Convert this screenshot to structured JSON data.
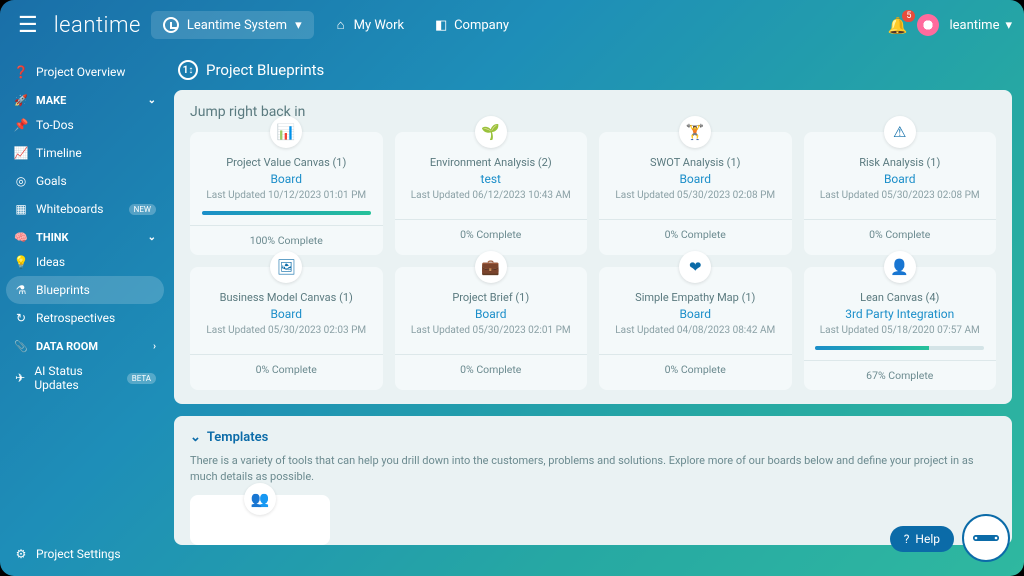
{
  "brand": "leantime",
  "projectSelector": {
    "label": "Leantime System"
  },
  "topNav": {
    "myWork": "My Work",
    "company": "Company"
  },
  "notifications": {
    "count": "5"
  },
  "user": {
    "name": "leantime"
  },
  "sidebar": {
    "overview": "Project Overview",
    "sections": {
      "make": {
        "label": "MAKE",
        "items": {
          "todos": "To-Dos",
          "timeline": "Timeline",
          "goals": "Goals",
          "whiteboards": "Whiteboards",
          "whiteboardsBadge": "NEW"
        }
      },
      "think": {
        "label": "THINK",
        "items": {
          "ideas": "Ideas",
          "blueprints": "Blueprints",
          "retros": "Retrospectives"
        }
      },
      "data": {
        "label": "DATA ROOM"
      }
    },
    "aiStatus": "AI Status Updates",
    "aiStatusBadge": "BETA",
    "settings": "Project Settings"
  },
  "page": {
    "title": "Project Blueprints"
  },
  "jumpBack": {
    "title": "Jump right back in",
    "cards": [
      {
        "name": "Project Value Canvas (1)",
        "sub": "Board",
        "date": "Last Updated 10/12/2023 01:01 PM",
        "progress": 100,
        "footer": "100% Complete"
      },
      {
        "name": "Environment Analysis (2)",
        "sub": "test",
        "date": "Last Updated 06/12/2023 10:43 AM",
        "progress": 0,
        "footer": "0% Complete"
      },
      {
        "name": "SWOT Analysis (1)",
        "sub": "Board",
        "date": "Last Updated 05/30/2023 02:08 PM",
        "progress": 0,
        "footer": "0% Complete"
      },
      {
        "name": "Risk Analysis (1)",
        "sub": "Board",
        "date": "Last Updated 05/30/2023 02:08 PM",
        "progress": 0,
        "footer": "0% Complete"
      },
      {
        "name": "Business Model Canvas (1)",
        "sub": "Board",
        "date": "Last Updated 05/30/2023 02:03 PM",
        "progress": 0,
        "footer": "0% Complete"
      },
      {
        "name": "Project Brief (1)",
        "sub": "Board",
        "date": "Last Updated 05/30/2023 02:01 PM",
        "progress": 0,
        "footer": "0% Complete"
      },
      {
        "name": "Simple Empathy Map (1)",
        "sub": "Board",
        "date": "Last Updated 04/08/2023 08:42 AM",
        "progress": 0,
        "footer": "0% Complete"
      },
      {
        "name": "Lean Canvas (4)",
        "sub": "3rd Party Integration",
        "date": "Last Updated 05/18/2020 07:57 AM",
        "progress": 67,
        "footer": "67% Complete"
      }
    ]
  },
  "templates": {
    "title": "Templates",
    "desc": "There is a variety of tools that can help you drill down into the customers, problems and solutions. Explore more of our boards below and define your project in as much details as possible."
  },
  "help": {
    "label": "Help"
  }
}
